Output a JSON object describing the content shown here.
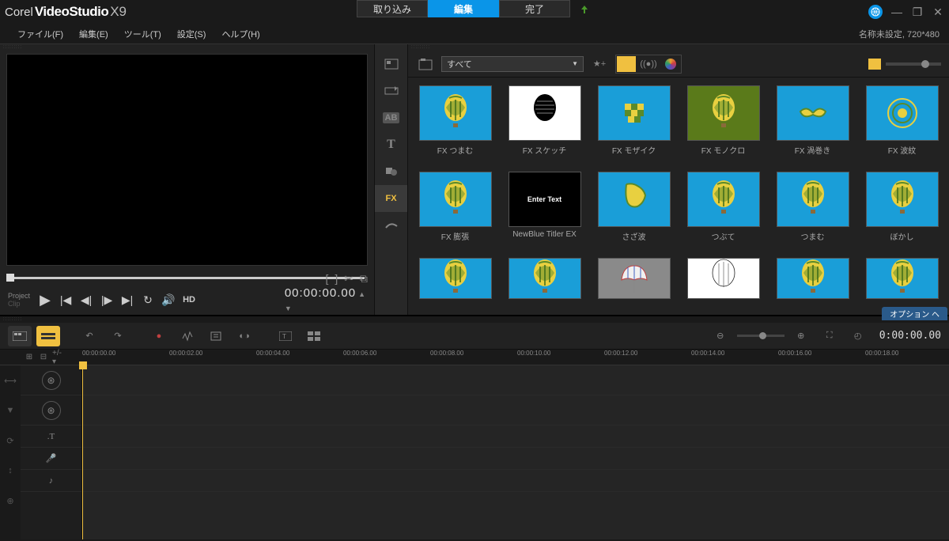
{
  "app": {
    "brand": "Corel",
    "product": "VideoStudio",
    "version": "X9"
  },
  "main_tabs": [
    {
      "label": "取り込み",
      "active": false
    },
    {
      "label": "編集",
      "active": true
    },
    {
      "label": "完了",
      "active": false
    }
  ],
  "menu": {
    "file": "ファイル(F)",
    "edit": "編集(E)",
    "tool": "ツール(T)",
    "settings": "設定(S)",
    "help": "ヘルプ(H)"
  },
  "project_info": "名称未設定, 720*480",
  "preview": {
    "mode_project": "Project",
    "mode_clip": "Clip",
    "hd_label": "HD",
    "timecode": "00:00:00.00"
  },
  "library": {
    "filter_dropdown": "すべて",
    "sidebar_tabs": [
      "media",
      "instant",
      "ab",
      "title",
      "graphic",
      "fx",
      "path"
    ],
    "active_tab": "fx",
    "fx_badge": "FX",
    "items_row1": [
      {
        "label": "FX つまむ",
        "bg": "#1a9ed8",
        "kind": "balloon-pinch"
      },
      {
        "label": "FX スケッチ",
        "bg": "#ffffff",
        "kind": "sketch"
      },
      {
        "label": "FX モザイク",
        "bg": "#1a9ed8",
        "kind": "mosaic"
      },
      {
        "label": "FX モノクロ",
        "bg": "#5a7a1a",
        "kind": "mono"
      },
      {
        "label": "FX 渦巻き",
        "bg": "#1a9ed8",
        "kind": "swirl"
      },
      {
        "label": "FX 波紋",
        "bg": "#1a9ed8",
        "kind": "ripple"
      }
    ],
    "items_row2": [
      {
        "label": "FX 膨張",
        "bg": "#1a9ed8",
        "kind": "balloon"
      },
      {
        "label": "NewBlue Titler EX",
        "bg": "#000000",
        "kind": "text",
        "text": "Enter Text"
      },
      {
        "label": "さざ波",
        "bg": "#1a9ed8",
        "kind": "wave"
      },
      {
        "label": "つぶて",
        "bg": "#1a9ed8",
        "kind": "balloon"
      },
      {
        "label": "つまむ",
        "bg": "#1a9ed8",
        "kind": "balloon"
      },
      {
        "label": "ぼかし",
        "bg": "#1a9ed8",
        "kind": "balloon"
      }
    ],
    "items_row3": [
      {
        "label": "",
        "bg": "#1a9ed8",
        "kind": "balloon"
      },
      {
        "label": "",
        "bg": "#1a9ed8",
        "kind": "balloon"
      },
      {
        "label": "",
        "bg": "#8a8a8a",
        "kind": "umbrella"
      },
      {
        "label": "",
        "bg": "#ffffff",
        "kind": "outline"
      },
      {
        "label": "",
        "bg": "#1a9ed8",
        "kind": "balloon"
      },
      {
        "label": "",
        "bg": "#1a9ed8",
        "kind": "balloon"
      }
    ],
    "options_label": "オプション ヘ"
  },
  "timeline": {
    "timecode": "0:00:00.00",
    "ruler_ticks": [
      "00:00:00.00",
      "00:00:02.00",
      "00:00:04.00",
      "00:00:06.00",
      "00:00:08.00",
      "00:00:10.00",
      "00:00:12.00",
      "00:00:14.00",
      "00:00:16.00",
      "00:00:18.00"
    ],
    "tracks": [
      "video",
      "overlay",
      "title",
      "voice",
      "music"
    ]
  }
}
